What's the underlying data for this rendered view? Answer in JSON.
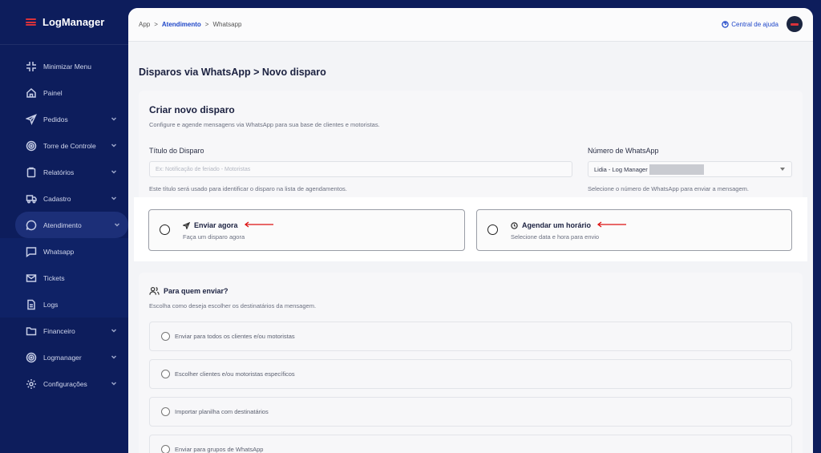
{
  "app": {
    "name": "LogManager"
  },
  "sidebar": {
    "items": [
      {
        "label": "Minimizar Menu",
        "icon": "minimize-icon",
        "chevron": false
      },
      {
        "label": "Painel",
        "icon": "home-icon",
        "chevron": false
      },
      {
        "label": "Pedidos",
        "icon": "send-icon",
        "chevron": true
      },
      {
        "label": "Torre de Controle",
        "icon": "target-icon",
        "chevron": true
      },
      {
        "label": "Relatórios",
        "icon": "clipboard-icon",
        "chevron": true
      },
      {
        "label": "Cadastro",
        "icon": "truck-icon",
        "chevron": true
      },
      {
        "label": "Atendimento",
        "icon": "chat-icon",
        "chevron": true,
        "active": true
      },
      {
        "label": "Whatsapp",
        "icon": "message-icon",
        "chevron": false,
        "sub": true
      },
      {
        "label": "Tickets",
        "icon": "mail-icon",
        "chevron": false,
        "sub": true
      },
      {
        "label": "Logs",
        "icon": "file-icon",
        "chevron": false,
        "sub": true
      },
      {
        "label": "Financeiro",
        "icon": "folder-icon",
        "chevron": true
      },
      {
        "label": "Logmanager",
        "icon": "target-icon",
        "chevron": true
      },
      {
        "label": "Configurações",
        "icon": "gear-icon",
        "chevron": true
      }
    ]
  },
  "topbar": {
    "breadcrumb": [
      "App",
      ">",
      "Atendimento",
      ">",
      "Whatsapp"
    ],
    "help_label": "Central de ajuda"
  },
  "page": {
    "title": "Disparos via WhatsApp > Novo disparo"
  },
  "create_card": {
    "title": "Criar novo disparo",
    "subtitle": "Configure e agende mensagens via WhatsApp para sua base de clientes e motoristas.",
    "title_field": {
      "label": "Título do Disparo",
      "placeholder": "Ex: Notificação de feriado - Motoristas",
      "hint": "Este título será usado para identificar o disparo na lista de agendamentos."
    },
    "number_field": {
      "label": "Número de WhatsApp",
      "value": "Lidia - Log Manager",
      "hint": "Selecione o número de WhatsApp para enviar a mensagem."
    }
  },
  "send_options": [
    {
      "title": "Enviar agora",
      "subtitle": "Faça um disparo agora",
      "icon": "send-icon"
    },
    {
      "title": "Agendar um horário",
      "subtitle": "Selecione data e hora para envio",
      "icon": "clock-icon"
    }
  ],
  "recipients_card": {
    "title": "Para quem enviar?",
    "subtitle": "Escolha como deseja escolher os destinatários da mensagem.",
    "options": [
      "Enviar para todos os clientes e/ou motoristas",
      "Escolher clientes e/ou motoristas específicos",
      "Importar planilha com destinatários",
      "Enviar para grupos de WhatsApp"
    ]
  },
  "colors": {
    "sidebar": "#0d1d5c",
    "accent": "#1f47c9",
    "brand_red": "#d9323a",
    "annotation_arrow": "#dd1111"
  }
}
